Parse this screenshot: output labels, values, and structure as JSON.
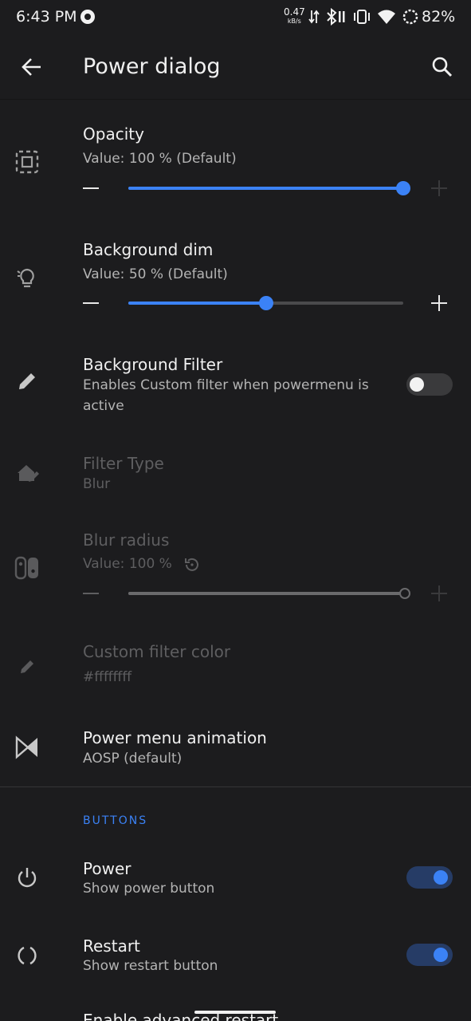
{
  "status_bar": {
    "time": "6:43 PM",
    "net_speed_value": "0.47",
    "net_speed_unit": "kB/s",
    "battery": "82%"
  },
  "app_bar": {
    "title": "Power dialog",
    "icons": [
      "arrow-back-icon",
      "search-icon"
    ]
  },
  "settings": {
    "opacity": {
      "title": "Opacity",
      "value_text": "Value: 100 % (Default)",
      "level": 100
    },
    "background_dim": {
      "title": "Background dim",
      "value_text": "Value: 50 % (Default)",
      "level": 50
    },
    "background_filter": {
      "title": "Background Filter",
      "summary": "Enables Custom filter when powermenu is active",
      "enabled": false
    },
    "filter_type": {
      "title": "Filter Type",
      "value": "Blur"
    },
    "blur_radius": {
      "title": "Blur radius",
      "value_text": "Value: 100 %",
      "level": 100
    },
    "custom_filter_color": {
      "title": "Custom filter color",
      "value": "#ffffffff"
    },
    "power_menu_animation": {
      "title": "Power menu animation",
      "value": "AOSP (default)"
    }
  },
  "buttons_section": {
    "header": "BUTTONS",
    "power": {
      "title": "Power",
      "summary": "Show power button",
      "enabled": true
    },
    "restart": {
      "title": "Restart",
      "summary": "Show restart button",
      "enabled": true
    },
    "advanced_restart": {
      "title": "Enable advanced restart"
    }
  },
  "colors": {
    "background": "#1c1c1e",
    "accent": "#3b82f6",
    "disabled_text": "#5e5e60"
  }
}
